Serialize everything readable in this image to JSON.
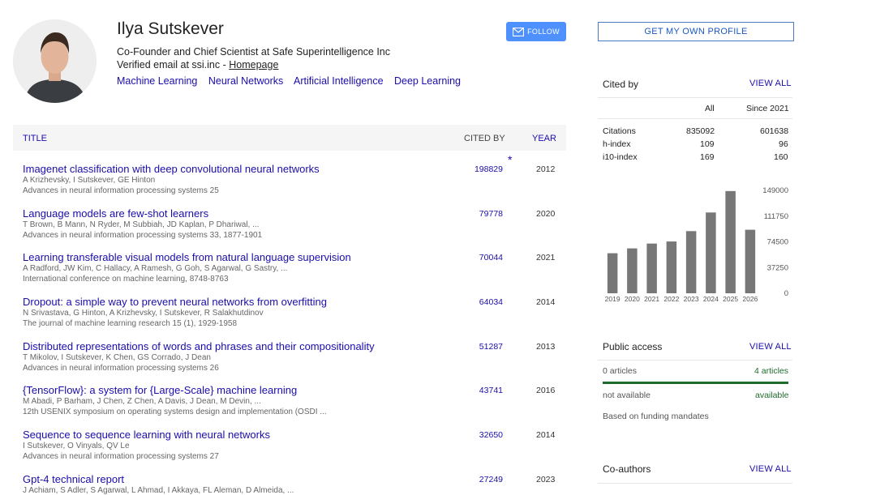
{
  "profile": {
    "name": "Ilya Sutskever",
    "affiliation": "Co-Founder and Chief Scientist at Safe Superintelligence Inc",
    "email_text": "Verified email at ssi.inc - ",
    "homepage_label": "Homepage",
    "interests": [
      "Machine Learning",
      "Neural Networks",
      "Artificial Intelligence",
      "Deep Learning"
    ],
    "follow_label": "FOLLOW",
    "get_profile_label": "GET MY OWN PROFILE"
  },
  "table": {
    "col_title": "TITLE",
    "col_cited": "CITED BY",
    "col_year": "YEAR",
    "rows": [
      {
        "title": "Imagenet classification with deep convolutional neural networks",
        "authors": "A Krizhevsky, I Sutskever, GE Hinton",
        "venue": "Advances in neural information processing systems 25",
        "cites": "198829",
        "year": "2012",
        "star": "*"
      },
      {
        "title": "Language models are few-shot learners",
        "authors": "T Brown, B Mann, N Ryder, M Subbiah, JD Kaplan, P Dhariwal, ...",
        "venue": "Advances in neural information processing systems 33, 1877-1901",
        "cites": "79778",
        "year": "2020"
      },
      {
        "title": "Learning transferable visual models from natural language supervision",
        "authors": "A Radford, JW Kim, C Hallacy, A Ramesh, G Goh, S Agarwal, G Sastry, ...",
        "venue": "International conference on machine learning, 8748-8763",
        "cites": "70044",
        "year": "2021"
      },
      {
        "title": "Dropout: a simple way to prevent neural networks from overfitting",
        "authors": "N Srivastava, G Hinton, A Krizhevsky, I Sutskever, R Salakhutdinov",
        "venue": "The journal of machine learning research 15 (1), 1929-1958",
        "cites": "64034",
        "year": "2014"
      },
      {
        "title": "Distributed representations of words and phrases and their compositionality",
        "authors": "T Mikolov, I Sutskever, K Chen, GS Corrado, J Dean",
        "venue": "Advances in neural information processing systems 26",
        "cites": "51287",
        "year": "2013"
      },
      {
        "title": "{TensorFlow}: a system for {Large-Scale} machine learning",
        "authors": "M Abadi, P Barham, J Chen, Z Chen, A Davis, J Dean, M Devin, ...",
        "venue": "12th USENIX symposium on operating systems design and implementation (OSDI ...",
        "cites": "43741",
        "year": "2016"
      },
      {
        "title": "Sequence to sequence learning with neural networks",
        "authors": "I Sutskever, O Vinyals, QV Le",
        "venue": "Advances in neural information processing systems 27",
        "cites": "32650",
        "year": "2014"
      },
      {
        "title": "Gpt-4 technical report",
        "authors": "J Achiam, S Adler, S Agarwal, L Ahmad, I Akkaya, FL Aleman, D Almeida, ...",
        "venue": "",
        "cites": "27249",
        "year": "2023"
      }
    ]
  },
  "cited_by": {
    "heading": "Cited by",
    "view_all": "VIEW ALL",
    "col_all": "All",
    "col_since": "Since 2021",
    "stats": [
      {
        "label": "Citations",
        "all": "835092",
        "since": "601638"
      },
      {
        "label": "h-index",
        "all": "109",
        "since": "96"
      },
      {
        "label": "i10-index",
        "all": "169",
        "since": "160"
      }
    ]
  },
  "chart_data": {
    "type": "bar",
    "categories": [
      "2019",
      "2020",
      "2021",
      "2022",
      "2023",
      "2024",
      "2025",
      "2026"
    ],
    "values": [
      58000,
      65000,
      72000,
      75000,
      90000,
      117000,
      148000,
      92000
    ],
    "ylim": [
      0,
      149000
    ],
    "yticks": [
      "149000",
      "111750",
      "74500",
      "37250",
      "0"
    ],
    "bar_color": "#777777"
  },
  "public_access": {
    "heading": "Public access",
    "view_all": "VIEW ALL",
    "left_count": "0 articles",
    "right_count": "4 articles",
    "left_status": "not available",
    "right_status": "available",
    "fraction_available": 1.0,
    "note": "Based on funding mandates",
    "bar_color": "#1e6b2b"
  },
  "coauthors": {
    "heading": "Co-authors",
    "view_all": "VIEW ALL"
  }
}
